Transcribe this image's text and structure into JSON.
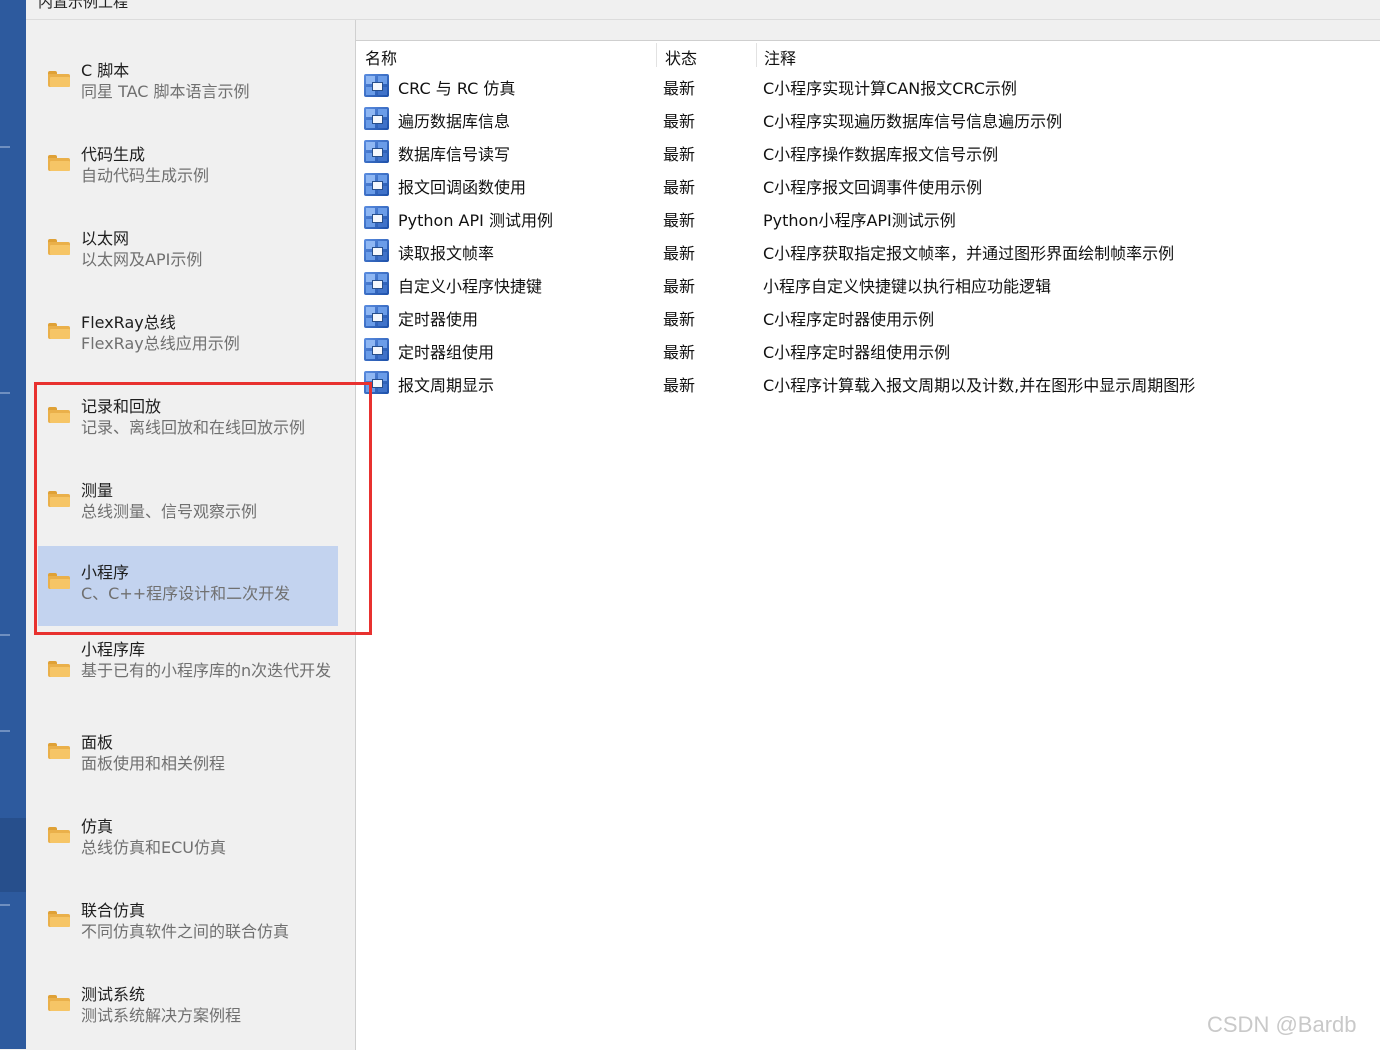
{
  "window": {
    "title": "内置示例工程"
  },
  "categories": [
    {
      "title": "C 脚本",
      "desc": "同星 TAC 脚本语言示例"
    },
    {
      "title": "代码生成",
      "desc": "自动代码生成示例"
    },
    {
      "title": "以太网",
      "desc": "以太网及API示例"
    },
    {
      "title": "FlexRay总线",
      "desc": "FlexRay总线应用示例"
    },
    {
      "title": "记录和回放",
      "desc": "记录、离线回放和在线回放示例"
    },
    {
      "title": "测量",
      "desc": "总线测量、信号观察示例"
    },
    {
      "title": "小程序",
      "desc": "C、C++程序设计和二次开发",
      "selected": true
    },
    {
      "title": "小程序库",
      "desc": "基于已有的小程序库的n次迭代开发"
    },
    {
      "title": "面板",
      "desc": "面板使用和相关例程"
    },
    {
      "title": "仿真",
      "desc": "总线仿真和ECU仿真"
    },
    {
      "title": "联合仿真",
      "desc": "不同仿真软件之间的联合仿真"
    },
    {
      "title": "测试系统",
      "desc": "测试系统解决方案例程"
    }
  ],
  "list": {
    "headers": {
      "name": "名称",
      "status": "状态",
      "note": "注释"
    },
    "rows": [
      {
        "name": "CRC 与 RC 仿真",
        "status": "最新",
        "note": "C小程序实现计算CAN报文CRC示例"
      },
      {
        "name": "遍历数据库信息",
        "status": "最新",
        "note": "C小程序实现遍历数据库信号信息遍历示例"
      },
      {
        "name": "数据库信号读写",
        "status": "最新",
        "note": "C小程序操作数据库报文信号示例"
      },
      {
        "name": "报文回调函数使用",
        "status": "最新",
        "note": "C小程序报文回调事件使用示例"
      },
      {
        "name": "Python API 测试用例",
        "status": "最新",
        "note": "Python小程序API测试示例"
      },
      {
        "name": "读取报文帧率",
        "status": "最新",
        "note": "C小程序获取指定报文帧率，并通过图形界面绘制帧率示例"
      },
      {
        "name": "自定义小程序快捷键",
        "status": "最新",
        "note": "小程序自定义快捷键以执行相应功能逻辑"
      },
      {
        "name": "定时器使用",
        "status": "最新",
        "note": "C小程序定时器使用示例"
      },
      {
        "name": "定时器组使用",
        "status": "最新",
        "note": "C小程序定时器组使用示例"
      },
      {
        "name": "报文周期显示",
        "status": "最新",
        "note": "C小程序计算载入报文周期以及计数,并在图形中显示周期图形"
      }
    ]
  },
  "colors": {
    "selected_bg": "#c3d3ef",
    "annotation": "#e8312f",
    "left_strip": "#2d5a9e"
  },
  "watermark": "CSDN @Bardb"
}
